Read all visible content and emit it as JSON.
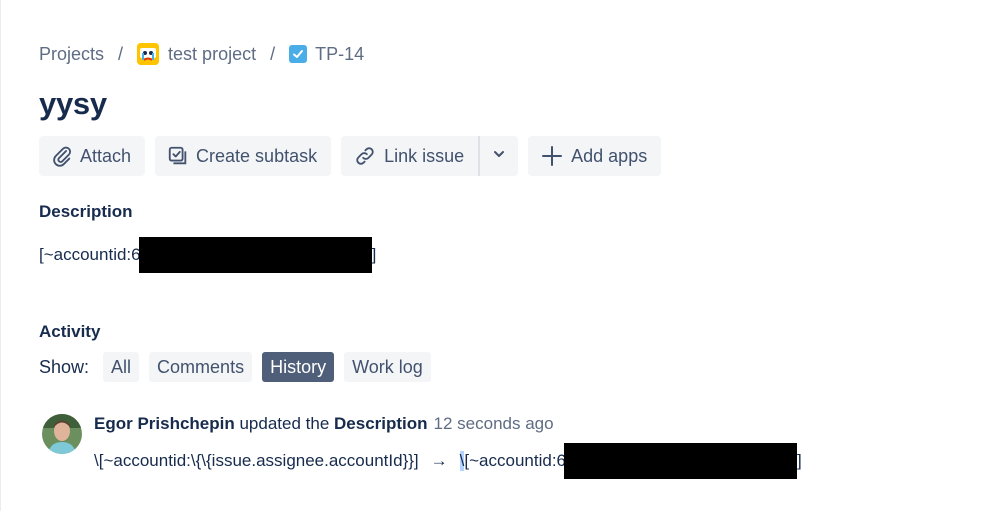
{
  "breadcrumbs": {
    "projects": "Projects",
    "separator": "/",
    "project": "test project",
    "issue_key": "TP-14"
  },
  "issue": {
    "title": "yysy"
  },
  "toolbar": {
    "attach": "Attach",
    "create_subtask": "Create subtask",
    "link_issue": "Link issue",
    "add_apps": "Add apps"
  },
  "description": {
    "label": "Description",
    "text_prefix": "[~accountid:6",
    "text_suffix": "]"
  },
  "activity": {
    "label": "Activity",
    "show_label": "Show:",
    "filters": [
      "All",
      "Comments",
      "History",
      "Work log"
    ],
    "active_filter": "History",
    "entry": {
      "author": "Egor Prishchepin",
      "action": " updated the ",
      "field": "Description",
      "time": "12 seconds ago",
      "old_value": "\\[~accountid:\\{\\{issue.assignee.accountId}}]",
      "arrow": "→",
      "new_value_selected": "\\",
      "new_value_prefix": "[~accountid:6",
      "new_value_suffix": "]"
    }
  },
  "colors": {
    "text": "#172b4d",
    "muted": "#5e6c84",
    "button_bg": "#f4f5f7",
    "active_filter_bg": "#505f79",
    "task_icon": "#4bade8"
  },
  "icons": {
    "project": "project-avatar-icon",
    "task": "task-checkbox-icon",
    "attach": "paperclip-icon",
    "subtask": "subtask-icon",
    "link": "link-icon",
    "more": "chevron-down-icon",
    "add": "plus-icon"
  }
}
